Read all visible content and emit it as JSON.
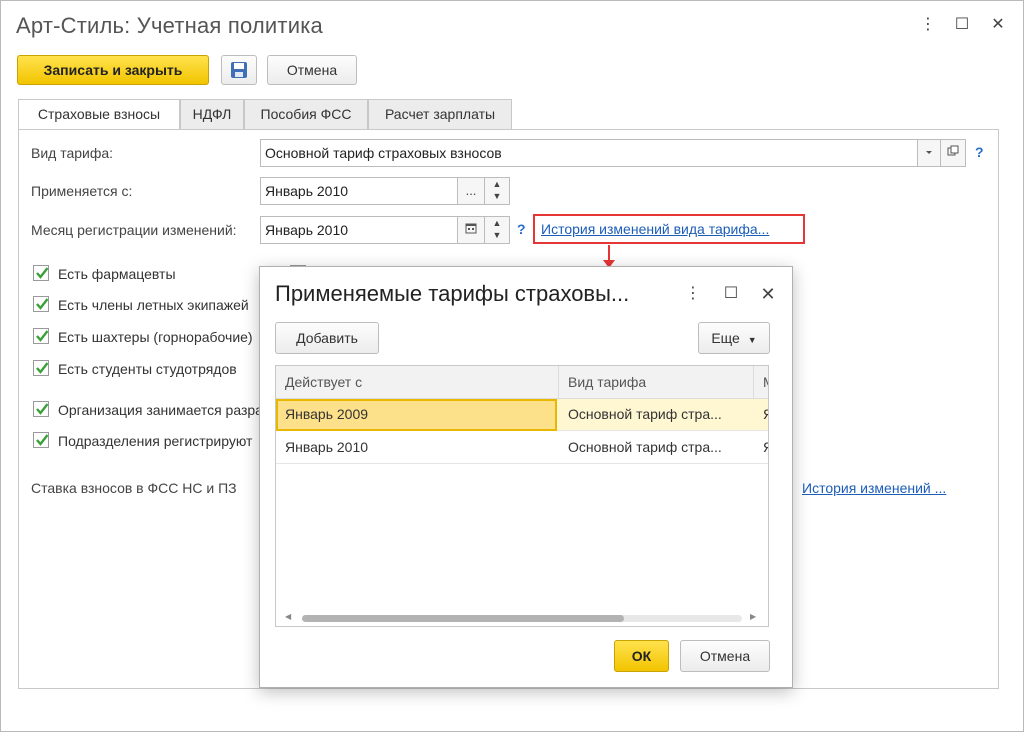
{
  "window": {
    "title": "Арт-Стиль: Учетная политика",
    "controls": {
      "more": "⋮",
      "maximize": "☐",
      "close": "✕"
    }
  },
  "toolbar": {
    "save_close_label": "Записать и закрыть",
    "cancel_label": "Отмена"
  },
  "tabs": [
    {
      "label": "Страховые взносы",
      "active": true
    },
    {
      "label": "НДФЛ",
      "active": false
    },
    {
      "label": "Пособия ФСС",
      "active": false
    },
    {
      "label": "Расчет зарплаты",
      "active": false
    }
  ],
  "form": {
    "tariff_label": "Вид тарифа:",
    "tariff_value": "Основной тариф страховых взносов",
    "applies_label": "Применяется с:",
    "applies_value": "Январь 2010",
    "reg_month_label": "Месяц регистрации изменений:",
    "reg_month_value": "Январь 2010",
    "history_link": "История изменений вида тарифа...",
    "help": "?",
    "ellipsis": "...",
    "checkboxes": [
      {
        "label": "Есть фармацевты",
        "checked": true
      },
      {
        "label": "Есть члены летных экипажей",
        "checked": true
      },
      {
        "label": "Есть шахтеры (горнорабочие)",
        "checked": true
      },
      {
        "label": "Есть студенты студотрядов",
        "checked": true
      },
      {
        "label": "Организация занимается разработкой",
        "checked": true
      },
      {
        "label": "Подразделения регистрируют",
        "checked": true
      }
    ],
    "fss_rate_label": "Ставка взносов в ФСС НС и ПЗ",
    "fss_history_link": "История изменений ..."
  },
  "dialog": {
    "title": "Применяемые тарифы страховы...",
    "add_label": "Добавить",
    "more_label": "Еще",
    "columns": [
      "Действует с",
      "Вид тарифа",
      "М"
    ],
    "rows": [
      {
        "date": "Январь 2009",
        "tariff": "Основной тариф стра...",
        "extra": "Я",
        "selected": true
      },
      {
        "date": "Январь 2010",
        "tariff": "Основной тариф стра...",
        "extra": "Я",
        "selected": false
      }
    ],
    "ok_label": "ОК",
    "cancel_label": "Отмена"
  },
  "colors": {
    "primary_button": "#f2c400",
    "link": "#1c5db8",
    "highlight_box": "#e53535",
    "check": "#3aa03a",
    "selected_row": "#fff6d2"
  }
}
